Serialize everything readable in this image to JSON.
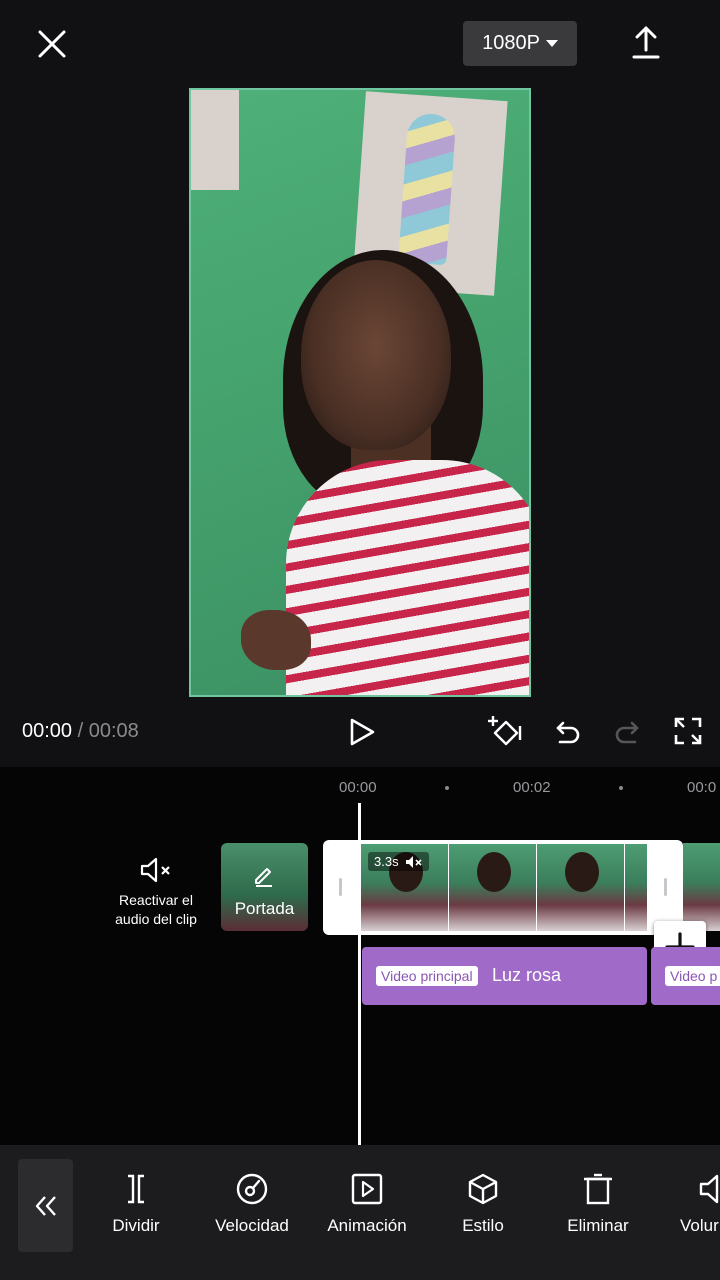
{
  "topbar": {
    "resolution": "1080P"
  },
  "playback": {
    "current_time": "00:00",
    "separator": "/",
    "total_time": "00:08"
  },
  "ruler": {
    "labels": [
      "00:00",
      "00:02",
      "00:0"
    ]
  },
  "track": {
    "mute_label": "Reactivar el audio del clip",
    "cover_label": "Portada",
    "clip_duration": "3.3s"
  },
  "effects": [
    {
      "tag": "Video principal",
      "name": "Luz rosa"
    },
    {
      "tag": "Video p"
    }
  ],
  "toolbar": {
    "tools": [
      {
        "label": "Dividir",
        "icon": "split-icon"
      },
      {
        "label": "Velocidad",
        "icon": "speed-icon"
      },
      {
        "label": "Animación",
        "icon": "animation-icon"
      },
      {
        "label": "Estilo",
        "icon": "style-cube-icon"
      },
      {
        "label": "Eliminar",
        "icon": "trash-icon"
      },
      {
        "label": "Volur",
        "icon": "volume-icon"
      }
    ]
  },
  "colors": {
    "accent_effect": "#a06ac9",
    "preview_border": "#6fc6a0",
    "background": "#111113"
  }
}
